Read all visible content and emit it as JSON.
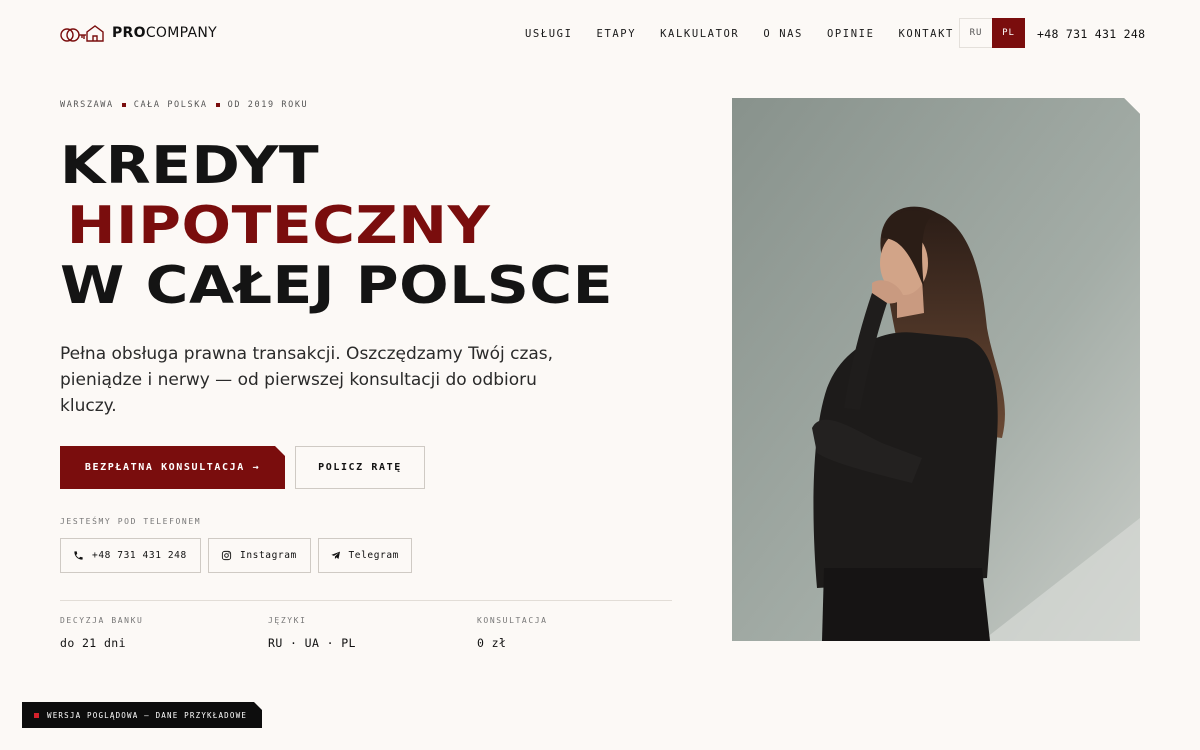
{
  "header": {
    "brand_bold": "PRO",
    "brand_rest": "COMPANY",
    "nav": [
      "USŁUGI",
      "ETAPY",
      "KALKULATOR",
      "O NAS",
      "OPINIE",
      "KONTAKT"
    ],
    "languages": [
      "RU",
      "PL"
    ],
    "active_language": "PL",
    "phone": "+48 731 431 248"
  },
  "hero": {
    "eyebrow": [
      "WARSZAWA",
      "CAŁA POLSKA",
      "OD 2019 ROKU"
    ],
    "title_line1": "KREDYT",
    "title_line2": "HIPOTECZNY",
    "title_line3": "W CAŁEJ POLSCE",
    "lead": "Pełna obsługa prawna transakcji. Oszczędzamy Twój czas, pieniądze i nerwy — od pierwszej konsultacji do odbioru kluczy.",
    "cta_primary": "BEZPŁATNA KONSULTACJA →",
    "cta_secondary": "POLICZ RATĘ",
    "contact_label": "JESTEŚMY POD TELEFONEM",
    "contacts": {
      "phone": "+48 731 431 248",
      "instagram": "Instagram",
      "telegram": "Telegram"
    }
  },
  "stats": [
    {
      "label": "DECYZJA BANKU",
      "value": "do 21 dni"
    },
    {
      "label": "JĘZYKI",
      "value": "RU · UA · PL"
    },
    {
      "label": "KONSULTACJA",
      "value": "0 zł"
    }
  ],
  "badge": {
    "text": "WERSJA POGLĄDOWA — DANE PRZYKŁADOWE"
  },
  "colors": {
    "accent": "#7a0d0d",
    "background": "#fcf9f6",
    "text": "#141414",
    "badge_dot": "#d4212b"
  },
  "icons": [
    "logo-house-key-icon",
    "phone-icon",
    "instagram-icon",
    "telegram-icon",
    "arrow-right-icon"
  ]
}
